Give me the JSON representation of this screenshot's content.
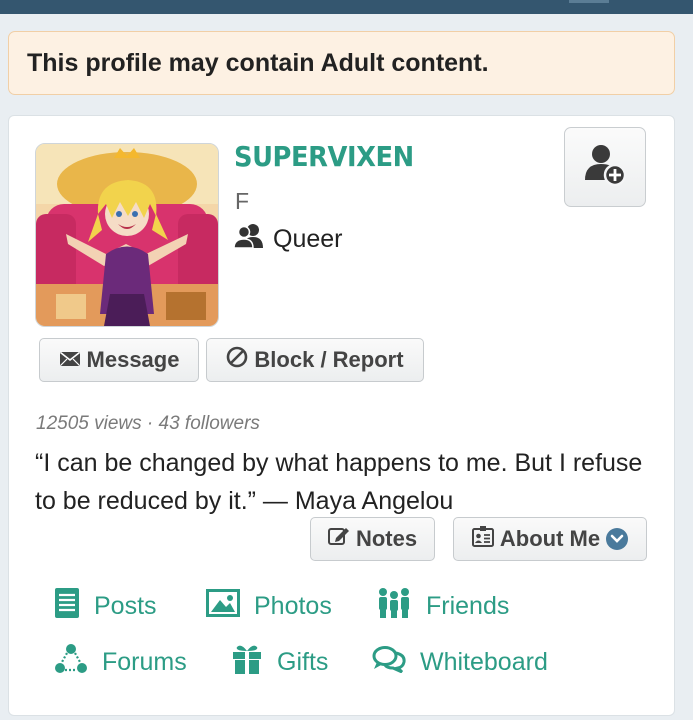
{
  "warning": {
    "text": "This profile may contain Adult content."
  },
  "profile": {
    "username": "SUPERVIXEN",
    "gender": "F",
    "orientation": "Queer",
    "stats": "12505 views · 43 followers",
    "bio": "“I can be changed by what happens to me. But I refuse to be reduced by it.” — Maya Angelou"
  },
  "actions": {
    "message_label": "Message",
    "block_label": "Block / Report",
    "notes_label": "Notes",
    "about_label": "About Me"
  },
  "nav": {
    "posts": "Posts",
    "photos": "Photos",
    "friends": "Friends",
    "forums": "Forums",
    "gifts": "Gifts",
    "whiteboard": "Whiteboard"
  },
  "icons": {
    "add_friend": "add-friend-icon",
    "orientation": "people-icon",
    "message": "envelope-icon",
    "block": "block-icon",
    "notes": "edit-icon",
    "about": "id-card-icon",
    "posts": "document-icon",
    "photos": "photo-icon",
    "friends": "group-icon",
    "forums": "forums-icon",
    "gifts": "gift-icon",
    "whiteboard": "chat-bubbles-icon"
  },
  "colors": {
    "accent": "#2c9c85",
    "header_bar": "#34566f",
    "warning_bg": "#fdf1e3",
    "warning_border": "#f1cfa6"
  }
}
